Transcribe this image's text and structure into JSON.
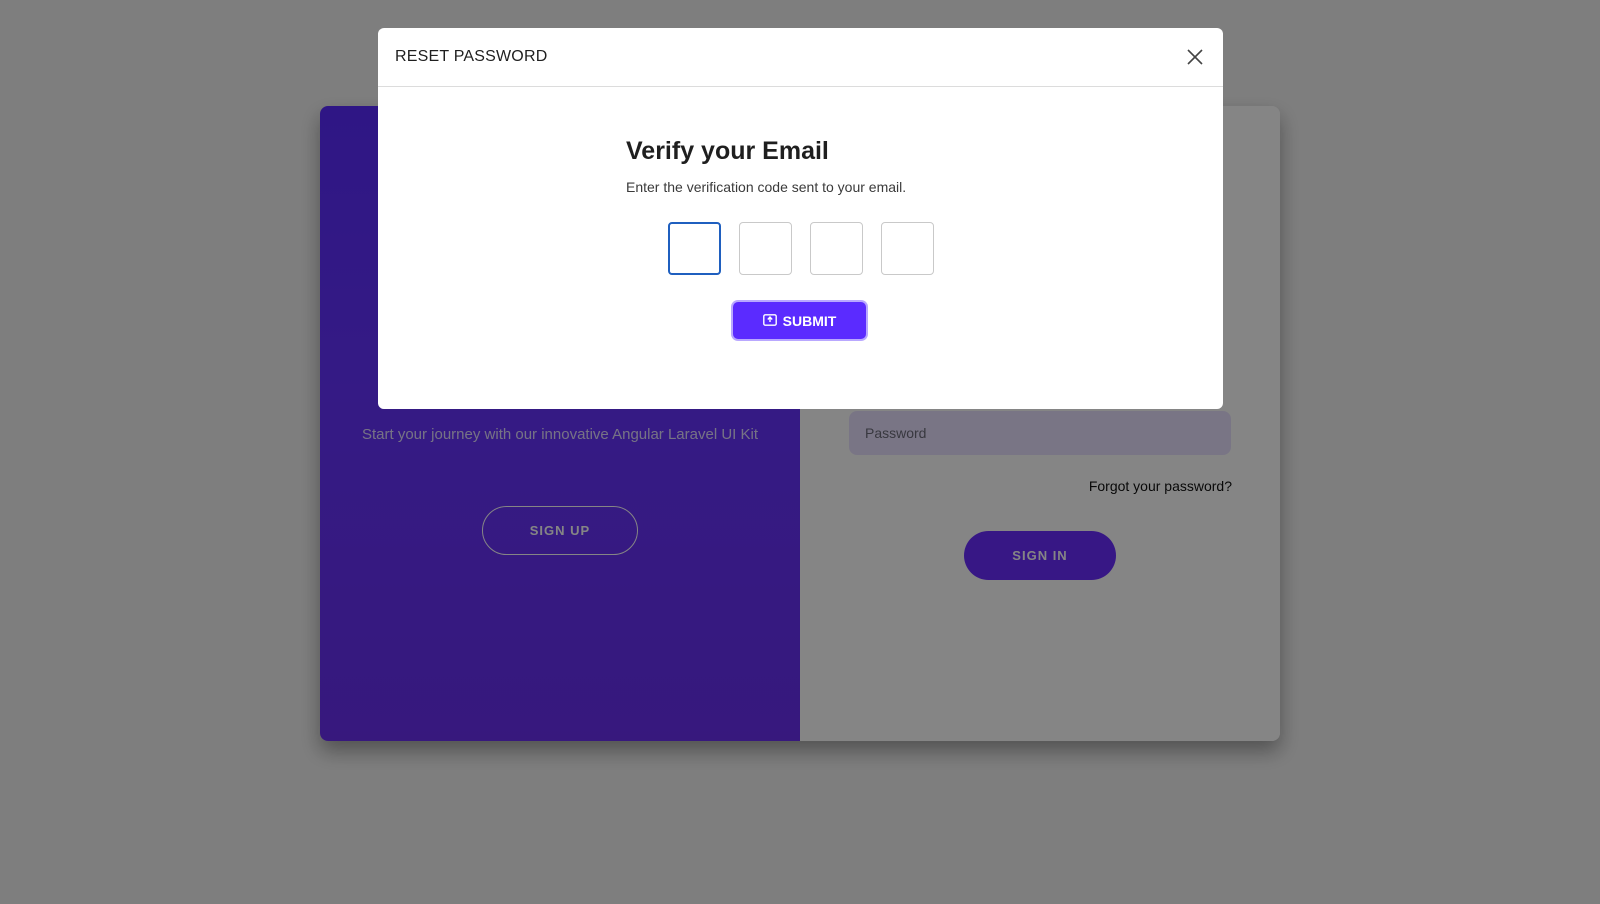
{
  "background_card": {
    "left_panel": {
      "subtitle": "Start your journey with our innovative Angular Laravel UI Kit",
      "signup_label": "SIGN UP"
    },
    "right_panel": {
      "password_placeholder": "Password",
      "forgot_label": "Forgot your password?",
      "signin_label": "SIGN IN"
    }
  },
  "modal": {
    "title": "RESET PASSWORD",
    "heading": "Verify your Email",
    "subtitle": "Enter the verification code sent to your email.",
    "code_values": [
      "",
      "",
      "",
      ""
    ],
    "submit_label": "SUBMIT",
    "close_icon": "close-icon",
    "submit_icon": "submit-icon"
  },
  "colors": {
    "accent": "#5b2bff",
    "left_panel": "#6633ff",
    "input_bg": "#e9e1ff",
    "active_border": "#1f5fbf"
  }
}
